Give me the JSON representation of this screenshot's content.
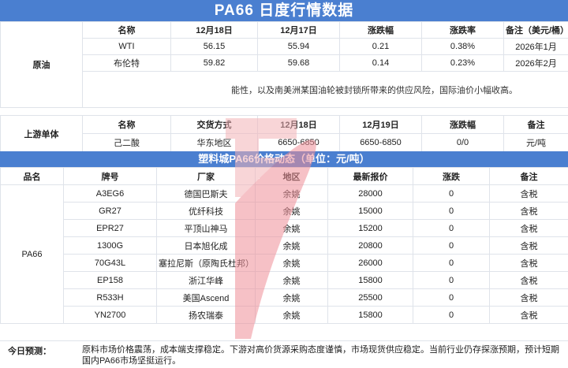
{
  "title": "PA66 日度行情数据",
  "crude": {
    "section_label": "原油",
    "headers": [
      "名称",
      "12月18日",
      "12月17日",
      "涨跌幅",
      "涨跌率",
      "备注（美元/桶）"
    ],
    "rows": [
      [
        "WTI",
        "56.15",
        "55.94",
        "0.21",
        "0.38%",
        "2026年1月"
      ],
      [
        "布伦特",
        "59.82",
        "59.68",
        "0.14",
        "0.23%",
        "2026年2月"
      ]
    ],
    "note": "能性，以及南美洲某国油轮被封锁所带来的供应风险，国际油价小幅收高。"
  },
  "upstream": {
    "section_label": "上游单体",
    "headers": [
      "名称",
      "交货方式",
      "12月18日",
      "12月19日",
      "涨跌幅",
      "备注"
    ],
    "rows": [
      [
        "己二酸",
        "华东地区",
        "6650-6850",
        "6650-6850",
        "0/0",
        "元/吨"
      ]
    ]
  },
  "pa66": {
    "title": "塑料城PA66价格动态（单位：元/吨）",
    "headers": [
      "品名",
      "牌号",
      "厂家",
      "地区",
      "最新报价",
      "涨跌",
      "备注"
    ],
    "product": "PA66",
    "rows": [
      [
        "A3EG6",
        "德国巴斯夫",
        "余姚",
        "28000",
        "0",
        "含税"
      ],
      [
        "GR27",
        "优纤科技",
        "余姚",
        "15000",
        "0",
        "含税"
      ],
      [
        "EPR27",
        "平顶山神马",
        "余姚",
        "15200",
        "0",
        "含税"
      ],
      [
        "1300G",
        "日本旭化成",
        "余姚",
        "20800",
        "0",
        "含税"
      ],
      [
        "70G43L",
        "塞拉尼斯（原陶氏杜邦）",
        "余姚",
        "26000",
        "0",
        "含税"
      ],
      [
        "EP158",
        "浙江华峰",
        "余姚",
        "15800",
        "0",
        "含税"
      ],
      [
        "R533H",
        "美国Ascend",
        "余姚",
        "25500",
        "0",
        "含税"
      ],
      [
        "YN2700",
        "扬农瑞泰",
        "余姚",
        "15800",
        "0",
        "含税"
      ]
    ]
  },
  "forecast": {
    "label": "今日预测：",
    "text": "原料市场价格震荡，成本端支撑稳定。下游对高价货源采购态度谨慎，市场现货供应稳定。当前行业仍存探涨预期，预计短期国内PA66市场坚挺运行。"
  },
  "colors": {
    "banner": "#4a7fd0",
    "watermark": "#f0a0a8"
  }
}
